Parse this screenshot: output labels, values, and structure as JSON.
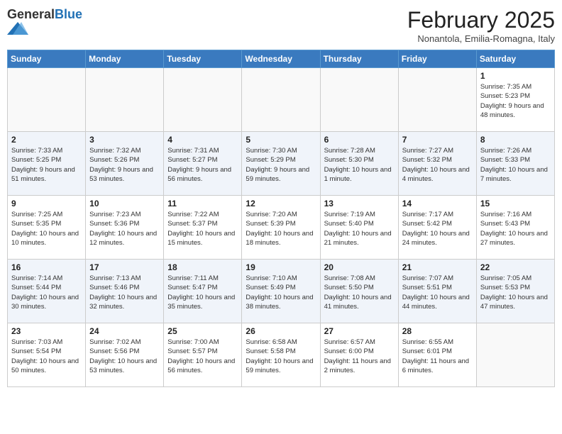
{
  "header": {
    "logo_general": "General",
    "logo_blue": "Blue",
    "month": "February 2025",
    "location": "Nonantola, Emilia-Romagna, Italy"
  },
  "weekdays": [
    "Sunday",
    "Monday",
    "Tuesday",
    "Wednesday",
    "Thursday",
    "Friday",
    "Saturday"
  ],
  "weeks": [
    [
      {
        "day": "",
        "info": ""
      },
      {
        "day": "",
        "info": ""
      },
      {
        "day": "",
        "info": ""
      },
      {
        "day": "",
        "info": ""
      },
      {
        "day": "",
        "info": ""
      },
      {
        "day": "",
        "info": ""
      },
      {
        "day": "1",
        "info": "Sunrise: 7:35 AM\nSunset: 5:23 PM\nDaylight: 9 hours and 48 minutes."
      }
    ],
    [
      {
        "day": "2",
        "info": "Sunrise: 7:33 AM\nSunset: 5:25 PM\nDaylight: 9 hours and 51 minutes."
      },
      {
        "day": "3",
        "info": "Sunrise: 7:32 AM\nSunset: 5:26 PM\nDaylight: 9 hours and 53 minutes."
      },
      {
        "day": "4",
        "info": "Sunrise: 7:31 AM\nSunset: 5:27 PM\nDaylight: 9 hours and 56 minutes."
      },
      {
        "day": "5",
        "info": "Sunrise: 7:30 AM\nSunset: 5:29 PM\nDaylight: 9 hours and 59 minutes."
      },
      {
        "day": "6",
        "info": "Sunrise: 7:28 AM\nSunset: 5:30 PM\nDaylight: 10 hours and 1 minute."
      },
      {
        "day": "7",
        "info": "Sunrise: 7:27 AM\nSunset: 5:32 PM\nDaylight: 10 hours and 4 minutes."
      },
      {
        "day": "8",
        "info": "Sunrise: 7:26 AM\nSunset: 5:33 PM\nDaylight: 10 hours and 7 minutes."
      }
    ],
    [
      {
        "day": "9",
        "info": "Sunrise: 7:25 AM\nSunset: 5:35 PM\nDaylight: 10 hours and 10 minutes."
      },
      {
        "day": "10",
        "info": "Sunrise: 7:23 AM\nSunset: 5:36 PM\nDaylight: 10 hours and 12 minutes."
      },
      {
        "day": "11",
        "info": "Sunrise: 7:22 AM\nSunset: 5:37 PM\nDaylight: 10 hours and 15 minutes."
      },
      {
        "day": "12",
        "info": "Sunrise: 7:20 AM\nSunset: 5:39 PM\nDaylight: 10 hours and 18 minutes."
      },
      {
        "day": "13",
        "info": "Sunrise: 7:19 AM\nSunset: 5:40 PM\nDaylight: 10 hours and 21 minutes."
      },
      {
        "day": "14",
        "info": "Sunrise: 7:17 AM\nSunset: 5:42 PM\nDaylight: 10 hours and 24 minutes."
      },
      {
        "day": "15",
        "info": "Sunrise: 7:16 AM\nSunset: 5:43 PM\nDaylight: 10 hours and 27 minutes."
      }
    ],
    [
      {
        "day": "16",
        "info": "Sunrise: 7:14 AM\nSunset: 5:44 PM\nDaylight: 10 hours and 30 minutes."
      },
      {
        "day": "17",
        "info": "Sunrise: 7:13 AM\nSunset: 5:46 PM\nDaylight: 10 hours and 32 minutes."
      },
      {
        "day": "18",
        "info": "Sunrise: 7:11 AM\nSunset: 5:47 PM\nDaylight: 10 hours and 35 minutes."
      },
      {
        "day": "19",
        "info": "Sunrise: 7:10 AM\nSunset: 5:49 PM\nDaylight: 10 hours and 38 minutes."
      },
      {
        "day": "20",
        "info": "Sunrise: 7:08 AM\nSunset: 5:50 PM\nDaylight: 10 hours and 41 minutes."
      },
      {
        "day": "21",
        "info": "Sunrise: 7:07 AM\nSunset: 5:51 PM\nDaylight: 10 hours and 44 minutes."
      },
      {
        "day": "22",
        "info": "Sunrise: 7:05 AM\nSunset: 5:53 PM\nDaylight: 10 hours and 47 minutes."
      }
    ],
    [
      {
        "day": "23",
        "info": "Sunrise: 7:03 AM\nSunset: 5:54 PM\nDaylight: 10 hours and 50 minutes."
      },
      {
        "day": "24",
        "info": "Sunrise: 7:02 AM\nSunset: 5:56 PM\nDaylight: 10 hours and 53 minutes."
      },
      {
        "day": "25",
        "info": "Sunrise: 7:00 AM\nSunset: 5:57 PM\nDaylight: 10 hours and 56 minutes."
      },
      {
        "day": "26",
        "info": "Sunrise: 6:58 AM\nSunset: 5:58 PM\nDaylight: 10 hours and 59 minutes."
      },
      {
        "day": "27",
        "info": "Sunrise: 6:57 AM\nSunset: 6:00 PM\nDaylight: 11 hours and 2 minutes."
      },
      {
        "day": "28",
        "info": "Sunrise: 6:55 AM\nSunset: 6:01 PM\nDaylight: 11 hours and 6 minutes."
      },
      {
        "day": "",
        "info": ""
      }
    ]
  ]
}
